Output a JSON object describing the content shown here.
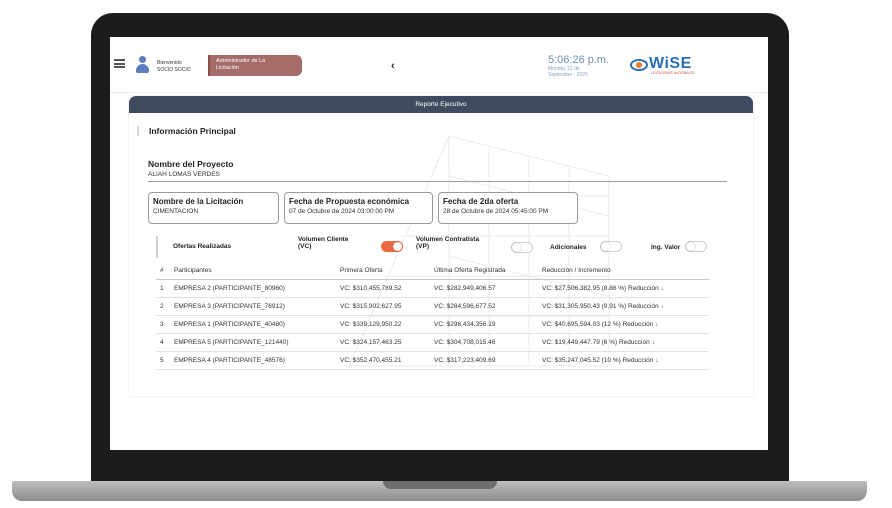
{
  "header": {
    "welcome_line1": "Bienvenido",
    "welcome_line2": "SOCIO SOCIO",
    "role_line1": "Administrador de La",
    "role_line2": "Licitación",
    "back_symbol": "‹",
    "time": "5:06:26 p.m.",
    "date_line1": "Monday 22 de",
    "date_line2": "September , 2025",
    "logo_word": "WiSE",
    "logo_tagline": "LICITACIONES NACIONALES"
  },
  "report": {
    "title": "Reporte Ejecutivo",
    "info_title": "Información Principal",
    "project_label": "Nombre del Proyecto",
    "project_name": "ALIAH LOMAS VERDES",
    "cards": [
      {
        "title": "Nombre de la Licitación",
        "value": "CIMENTACION"
      },
      {
        "title": "Fecha de Propuesta económica",
        "value": "07 de Octubre de 2024 03:00:00 PM"
      },
      {
        "title": "Fecha de 2da oferta",
        "value": "28 de Octubre de 2024 05:45:00 PM"
      }
    ],
    "filters": {
      "offers_label": "Ofertas Realizadas",
      "vc_label_1": "Volumen Cliente",
      "vc_label_2": "(VC)",
      "vc_on": true,
      "vp_label_1": "Volumen Contratista",
      "vp_label_2": "(VP)",
      "vp_on": false,
      "extras_label": "Adicionales",
      "extras_on": false,
      "value_label": "Ing. Valor",
      "value_on": false
    },
    "table": {
      "headers": [
        "#",
        "Participantes",
        "Primera Oferta",
        "Última Oferta Registrada",
        "Reducción / Incremento"
      ],
      "rows": [
        {
          "n": "1",
          "participant": "EMPRESA 2 (PARTICIPANTE_80960)",
          "first": "VC: $310,455,789.52",
          "last": "VC: $282,949,406.57",
          "change": "VC: $27,506,382.95 (8.86 %) Reducción"
        },
        {
          "n": "2",
          "participant": "EMPRESA 3 (PARTICIPANTE_76912)",
          "first": "VC: $315,902,627.95",
          "last": "VC: $284,596,677.52",
          "change": "VC: $31,305,950.43 (9.91 %) Reducción"
        },
        {
          "n": "3",
          "participant": "EMPRESA 1 (PARTICIPANTE_40480)",
          "first": "VC: $339,129,950.22",
          "last": "VC: $298,434,356.19",
          "change": "VC: $40,695,594.03 (12 %) Reducción"
        },
        {
          "n": "4",
          "participant": "EMPRESA 5 (PARTICIPANTE_121440)",
          "first": "VC: $324,157,463.25",
          "last": "VC: $304,708,015.46",
          "change": "VC: $19,449,447.79 (6 %) Reducción"
        },
        {
          "n": "5",
          "participant": "EMPRESA 4 (PARTICIPANTE_48576)",
          "first": "VC: $352,470,455.21",
          "last": "VC: $317,223,409.69",
          "change": "VC: $35,247,045.52 (10 %) Reducción"
        }
      ]
    }
  },
  "colors": {
    "report_header_bg": "#404a5e",
    "role_badge_bg": "#a56c69",
    "toggle_on": "#ea6b43",
    "clock_text": "#6e8fb5",
    "logo_blue": "#2a6fb0"
  },
  "icons": {
    "menu": "hamburger-icon",
    "user": "user-icon",
    "logo": "wise-eye-logo",
    "reduction": "arrow-down-icon"
  }
}
